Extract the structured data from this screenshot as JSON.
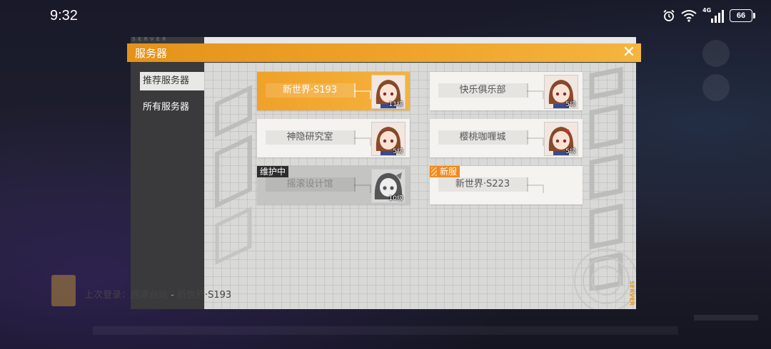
{
  "status_bar": {
    "time": "9:32",
    "network": "4G",
    "battery": "66"
  },
  "dialog": {
    "title": "服务器",
    "close_glyph": "✕",
    "brand_small": "SERVER",
    "brand_vertical": "SERVER",
    "accent_color": "#f0a128"
  },
  "sidebar": {
    "items": [
      {
        "label": "推荐服务器",
        "active": true
      },
      {
        "label": "所有服务器",
        "active": false
      }
    ]
  },
  "servers": [
    {
      "name": "新世界·S193",
      "level": "11级",
      "state": "selected",
      "badge": ""
    },
    {
      "name": "快乐俱乐部",
      "level": "5级",
      "state": "normal",
      "badge": ""
    },
    {
      "name": "神隐研究室",
      "level": "5级",
      "state": "normal",
      "badge": ""
    },
    {
      "name": "樱桃咖喱城",
      "level": "5级",
      "state": "normal",
      "badge": ""
    },
    {
      "name": "摇滚设计馆",
      "level": "10级",
      "state": "maintenance",
      "badge": "维护中"
    },
    {
      "name": "新世界·S223",
      "level": "",
      "state": "new",
      "badge": "新服"
    }
  ],
  "last_login": {
    "prefix": "上次登录：",
    "area": "西凉台站",
    "separator": " - ",
    "server": "新世界·S193"
  }
}
